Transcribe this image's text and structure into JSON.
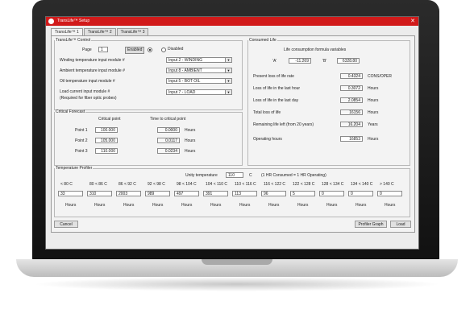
{
  "window": {
    "title": "TransLife™ Setup",
    "close_glyph": "✕"
  },
  "tabs": [
    "TransLife™ 1",
    "TransLife™ 2",
    "TransLife™ 3"
  ],
  "control": {
    "legend": "TransLife™ Control",
    "page_label": "Page",
    "page_value": "1",
    "enabled_label": "Enabled",
    "disabled_label": "Disabled",
    "selected_state": "enabled",
    "rows": [
      {
        "label": "Winding temperature input module #",
        "value": "Input 2 - WINDING"
      },
      {
        "label": "Ambient temperature input module #",
        "value": "Input 8 - AMBIENT"
      },
      {
        "label": "Oil temperature input module #",
        "value": "Input 5 - BOT OIL"
      },
      {
        "label": "Load current input module #",
        "value": "Input 7 - LOAD"
      }
    ],
    "note": "(Required for fiber optic probes)"
  },
  "forecast": {
    "legend": "Critical Forecast",
    "col1": "Critical point",
    "col2": "Time to critical point",
    "unit": "Hours",
    "points": [
      {
        "label": "Point 1",
        "critical": "100.000",
        "time": "0.0000"
      },
      {
        "label": "Point 2",
        "critical": "105.000",
        "time": "0.0117"
      },
      {
        "label": "Point 3",
        "critical": "110.000",
        "time": "0.0234"
      }
    ]
  },
  "consumed": {
    "legend": "Consumed Life",
    "formula_label": "Life consumption formula variables",
    "a_label": "'A'",
    "a_value": "-11.269",
    "b_label": "'B'",
    "b_value": "6328.80",
    "rows": [
      {
        "label": "Present loss of life rate",
        "value": "0.4324",
        "unit": "CONS/OPER"
      },
      {
        "label": "Loss of life in the last hour",
        "value": "0.3072",
        "unit": "Hours"
      },
      {
        "label": "Loss of life in the last day",
        "value": "2.0854",
        "unit": "Hours"
      },
      {
        "label": "Total loss of life",
        "value": "16156",
        "unit": "Hours"
      },
      {
        "label": "Remaining life left (from 20 years)",
        "value": "16.204",
        "unit": "Years"
      },
      {
        "label": "Operating hours",
        "value": "16853",
        "unit": "Hours"
      }
    ]
  },
  "profiler": {
    "legend": "Temperature Profiler",
    "unity_label": "Unity temperature",
    "unity_value": "110",
    "unity_unit": "C",
    "unity_note": "(1 HR Consumed = 1 HR Operating)",
    "unit": "Hours",
    "bins": [
      {
        "range": "< 80 C",
        "value": "33"
      },
      {
        "range": "80 < 86 C",
        "value": "310"
      },
      {
        "range": "86 < 92 C",
        "value": "2003"
      },
      {
        "range": "92 < 98 C",
        "value": "989"
      },
      {
        "range": "98 < 104 C",
        "value": "497"
      },
      {
        "range": "104 < 110 C",
        "value": "391"
      },
      {
        "range": "110 < 116 C",
        "value": "113"
      },
      {
        "range": "116 < 122 C",
        "value": "96"
      },
      {
        "range": "122 < 128 C",
        "value": "5"
      },
      {
        "range": "128 < 134 C",
        "value": "0"
      },
      {
        "range": "134 < 140 C",
        "value": "0"
      },
      {
        "range": "> 140 C",
        "value": "0"
      }
    ]
  },
  "footer": {
    "cancel": "Cancel",
    "profiler_graph": "Profiler Graph",
    "load": "Load"
  }
}
